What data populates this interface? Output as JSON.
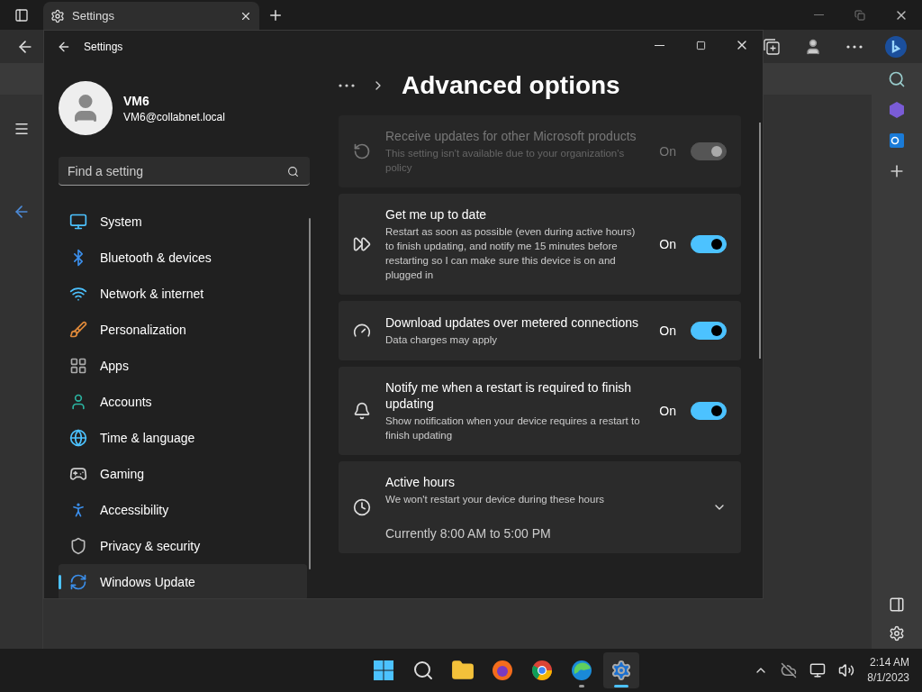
{
  "browser": {
    "tabs": [
      {
        "title": "Settings",
        "selected": true
      }
    ]
  },
  "settings_window": {
    "app_title": "Settings",
    "user": {
      "name": "VM6",
      "email": "VM6@collabnet.local"
    },
    "search": {
      "placeholder": "Find a setting"
    },
    "nav": [
      {
        "label": "System",
        "selected": false
      },
      {
        "label": "Bluetooth & devices",
        "selected": false
      },
      {
        "label": "Network & internet",
        "selected": false
      },
      {
        "label": "Personalization",
        "selected": false
      },
      {
        "label": "Apps",
        "selected": false
      },
      {
        "label": "Accounts",
        "selected": false
      },
      {
        "label": "Time & language",
        "selected": false
      },
      {
        "label": "Gaming",
        "selected": false
      },
      {
        "label": "Accessibility",
        "selected": false
      },
      {
        "label": "Privacy & security",
        "selected": false
      },
      {
        "label": "Windows Update",
        "selected": true
      }
    ],
    "page_title": "Advanced options",
    "options": [
      {
        "kind": "toggle",
        "title": "Receive updates for other Microsoft products",
        "description": "This setting isn't available due to your organization's policy",
        "state_label": "On",
        "on": true,
        "disabled": true
      },
      {
        "kind": "toggle",
        "title": "Get me up to date",
        "description": "Restart as soon as possible (even during active hours) to finish updating, and notify me 15 minutes before restarting so I can make sure this device is on and plugged in",
        "state_label": "On",
        "on": true,
        "disabled": false
      },
      {
        "kind": "toggle",
        "title": "Download updates over metered connections",
        "description": "Data charges may apply",
        "state_label": "On",
        "on": true,
        "disabled": false
      },
      {
        "kind": "toggle",
        "title": "Notify me when a restart is required to finish updating",
        "description": "Show notification when your device requires a restart to finish updating",
        "state_label": "On",
        "on": true,
        "disabled": false
      },
      {
        "kind": "expander",
        "title": "Active hours",
        "description": "We won't restart your device during these hours",
        "value": "Currently 8:00 AM to 5:00 PM",
        "expanded": false
      }
    ]
  },
  "taskbar": {
    "apps": [
      {
        "selected": false,
        "running": false
      },
      {
        "selected": false,
        "running": false
      },
      {
        "selected": false,
        "running": false
      },
      {
        "selected": false,
        "running": false
      },
      {
        "selected": false,
        "running": false
      },
      {
        "selected": false,
        "running": true
      },
      {
        "selected": true,
        "running": true
      }
    ],
    "time": "2:14 AM",
    "date": "8/1/2023"
  }
}
